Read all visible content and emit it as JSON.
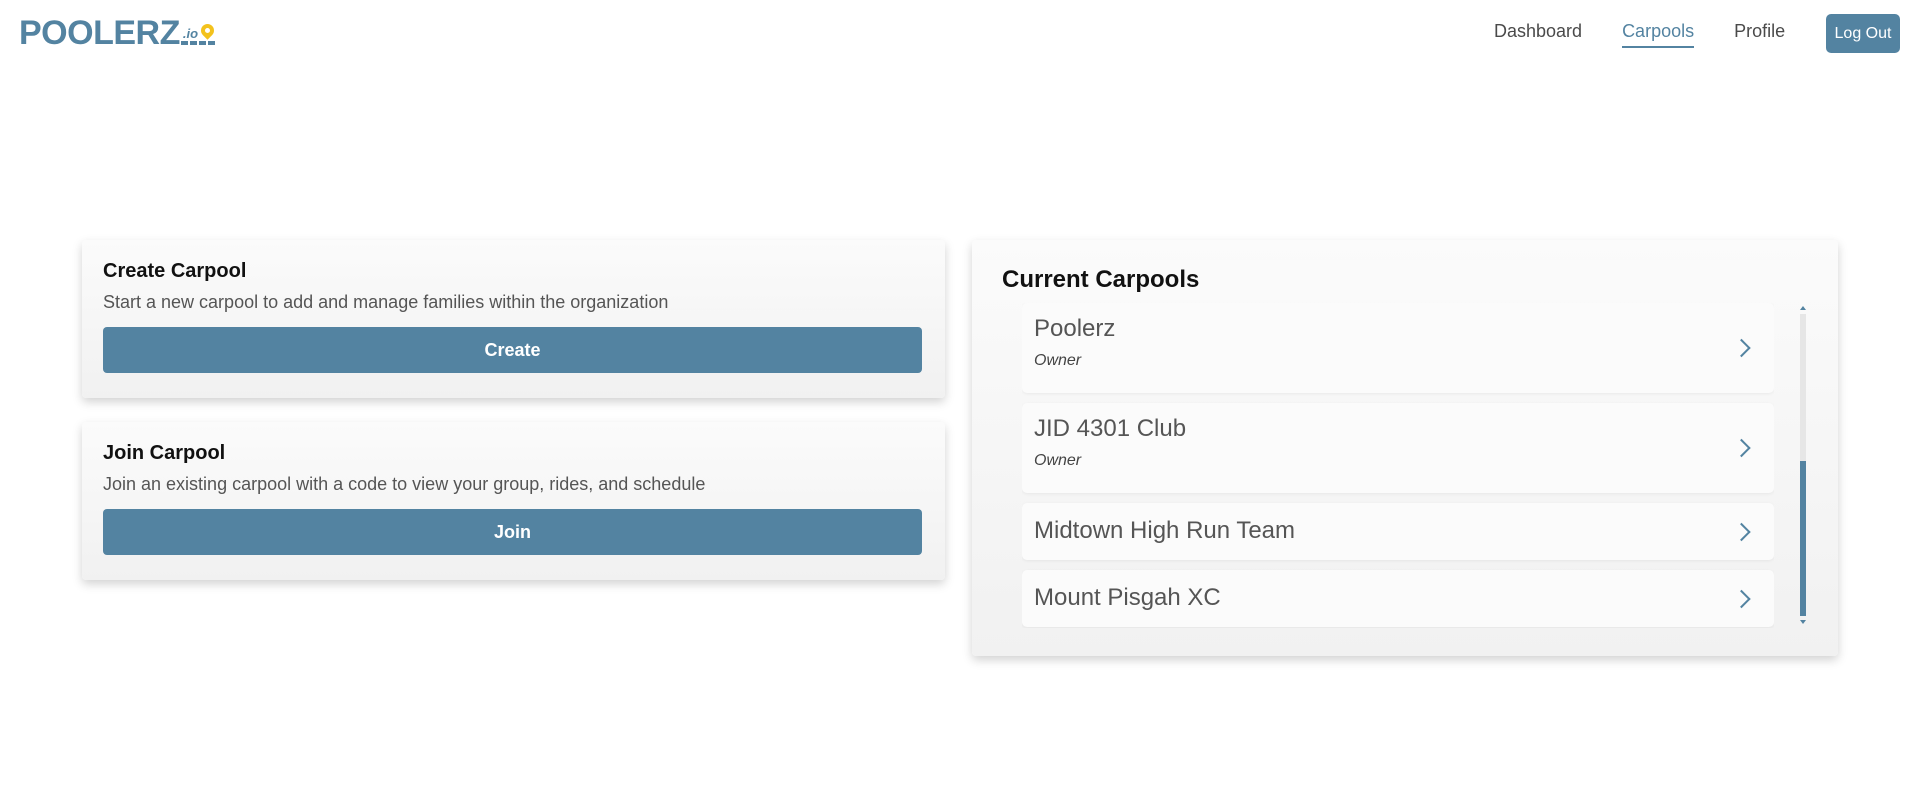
{
  "header": {
    "logo_text": "POOLERZ",
    "logo_suffix": ".io",
    "nav": [
      {
        "label": "Dashboard",
        "active": false
      },
      {
        "label": "Carpools",
        "active": true
      },
      {
        "label": "Profile",
        "active": false
      }
    ],
    "logout_label": "Log Out"
  },
  "create_card": {
    "title": "Create Carpool",
    "description": "Start a new carpool to add and manage families within the organization",
    "button_label": "Create"
  },
  "join_card": {
    "title": "Join Carpool",
    "description": "Join an existing carpool with a code to view your group, rides, and schedule",
    "button_label": "Join"
  },
  "current_carpools": {
    "title": "Current Carpools",
    "items": [
      {
        "name": "Poolerz",
        "role": "Owner"
      },
      {
        "name": "JID 4301 Club",
        "role": "Owner"
      },
      {
        "name": "Midtown High Run Team",
        "role": ""
      },
      {
        "name": "Mount Pisgah XC",
        "role": ""
      }
    ]
  },
  "colors": {
    "accent": "#5383a1",
    "logo_pin": "#f3c21d",
    "card_bg": "#f5f5f5"
  }
}
